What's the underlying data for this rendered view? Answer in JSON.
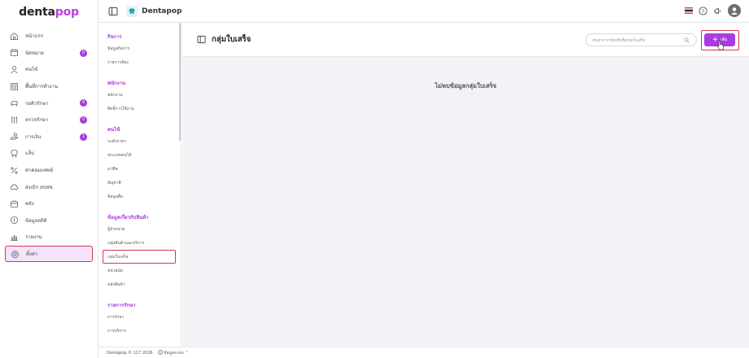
{
  "logo": {
    "part1": "denta",
    "part2": "pop"
  },
  "sidebar": {
    "items": [
      {
        "label": "หน้าแรก",
        "icon": "home-icon",
        "badge": ""
      },
      {
        "label": "นัดหมาย",
        "icon": "calendar-icon",
        "badge": "0"
      },
      {
        "label": "คนไข้",
        "icon": "user-icon",
        "badge": ""
      },
      {
        "label": "พื้นที่การทำงาน",
        "icon": "workspace-icon",
        "badge": ""
      },
      {
        "label": "รอคิวรักษา",
        "icon": "dental-chair-icon",
        "badge": "0"
      },
      {
        "label": "ตรวจรักษา",
        "icon": "tools-icon",
        "badge": "0"
      },
      {
        "label": "การเงิน",
        "icon": "payment-icon",
        "badge": "1"
      },
      {
        "label": "แล็บ",
        "icon": "tooth-icon",
        "badge": ""
      },
      {
        "label": "ค่าคอมแพทย์",
        "icon": "percent-icon",
        "badge": ""
      },
      {
        "label": "ส่งเบิก สปสช.",
        "icon": "cloud-upload-icon",
        "badge": ""
      },
      {
        "label": "คลัง",
        "icon": "inventory-icon",
        "badge": ""
      },
      {
        "label": "ข้อมูลสถิติ",
        "icon": "stats-icon",
        "badge": ""
      },
      {
        "label": "รายงาน",
        "icon": "report-icon",
        "badge": ""
      },
      {
        "label": "ตั้งค่า",
        "icon": "gear-icon",
        "badge": ""
      }
    ],
    "active_index": 13
  },
  "topbar": {
    "brand": "Dentapop"
  },
  "submenu": {
    "sections": [
      {
        "title": "กิจการ",
        "items": [
          "ข้อมูลกิจการ",
          "รายการห้อง"
        ]
      },
      {
        "title": "พนักงาน",
        "items": [
          "พนักงาน",
          "สิทธิ์การใช้งาน"
        ]
      },
      {
        "title": "คนไข้",
        "items": [
          "ระดับราคา",
          "ประเภทคนไข้",
          "อาชีพ",
          "สัญชาติ",
          "ข้อมูลสื่อ"
        ]
      },
      {
        "title": "ข้อมูลเกี่ยวกับสินค้า",
        "items": [
          "ผู้จำหน่าย",
          "กลุ่มสินค้าและบริการ",
          "กลุ่มใบเสร็จ",
          "หน่วยนับ",
          "คลังสินค้า"
        ]
      },
      {
        "title": "รายการรักษา",
        "items": [
          "การรักษา",
          "การบริการ"
        ]
      }
    ],
    "active_item": "กลุ่มใบเสร็จ"
  },
  "main": {
    "title": "กลุ่มใบเสร็จ",
    "search_placeholder": "ค้นหาจากรหัสหรือชื่อกลุ่มใบเสร็จ",
    "add_label": "เพิ่ม",
    "empty_text": "ไม่พบข้อมูลกลุ่มใบเสร็จ"
  },
  "footer": {
    "copyright": "Dentapop © 117 2026",
    "info": "ข้อมูลระบบ"
  },
  "colors": {
    "accent": "#a93ce0",
    "highlight_border": "#d9364d",
    "active_bg": "#f4e3fb"
  }
}
